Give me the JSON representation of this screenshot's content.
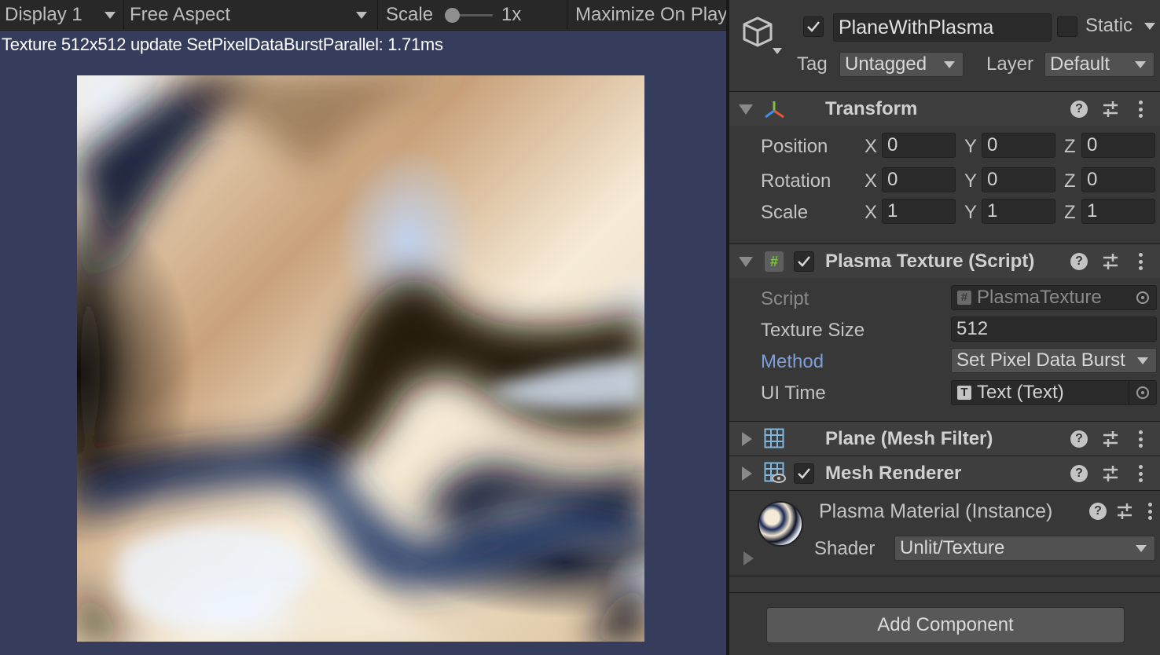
{
  "game_toolbar": {
    "display": "Display 1",
    "aspect": "Free Aspect",
    "scale_label": "Scale",
    "scale_value": "1x",
    "maximize": "Maximize On Play"
  },
  "game_view": {
    "stats_text": "Texture 512x512 update SetPixelDataBurstParallel: 1.71ms"
  },
  "inspector": {
    "object_name": "PlaneWithPlasma",
    "static_label": "Static",
    "tag_label": "Tag",
    "tag_value": "Untagged",
    "layer_label": "Layer",
    "layer_value": "Default",
    "transform": {
      "title": "Transform",
      "rows": [
        {
          "label": "Position",
          "x": "0",
          "y": "0",
          "z": "0"
        },
        {
          "label": "Rotation",
          "x": "0",
          "y": "0",
          "z": "0"
        },
        {
          "label": "Scale",
          "x": "1",
          "y": "1",
          "z": "1"
        }
      ],
      "axis_x": "X",
      "axis_y": "Y",
      "axis_z": "Z"
    },
    "plasma_script": {
      "title": "Plasma Texture (Script)",
      "script_label": "Script",
      "script_value": "PlasmaTexture",
      "texture_size_label": "Texture Size",
      "texture_size_value": "512",
      "method_label": "Method",
      "method_value": "Set Pixel Data Burst",
      "ui_time_label": "UI Time",
      "ui_time_value": "Text (Text)"
    },
    "mesh_filter": {
      "title": "Plane (Mesh Filter)"
    },
    "mesh_renderer": {
      "title": "Mesh Renderer"
    },
    "material": {
      "name": "Plasma Material (Instance)",
      "shader_label": "Shader",
      "shader_value": "Unlit/Texture"
    },
    "add_component": "Add Component"
  },
  "colors": {
    "game_background": "#363d5c",
    "inspector_background": "#383838",
    "method_label": "#7c9fdc"
  }
}
